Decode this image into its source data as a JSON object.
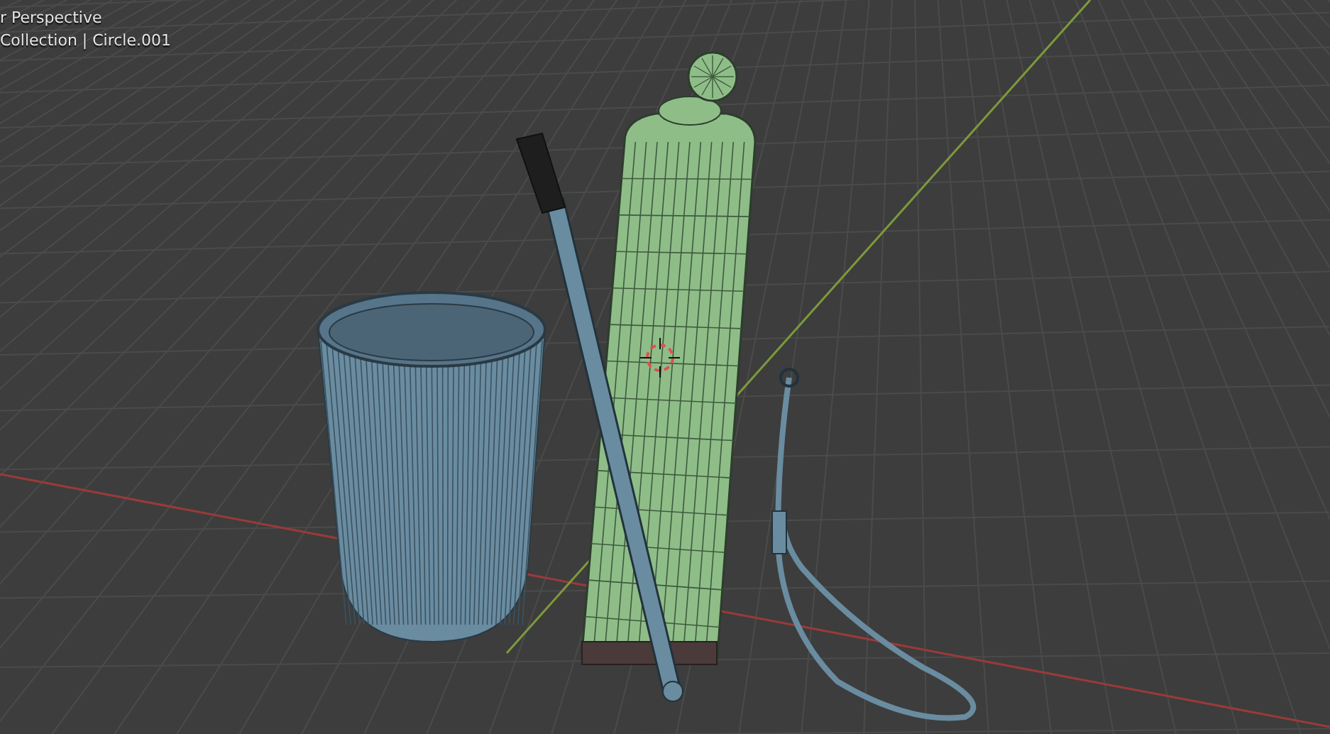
{
  "viewport": {
    "view_name": "r Perspective",
    "collection_info": "Collection | Circle.001"
  }
}
